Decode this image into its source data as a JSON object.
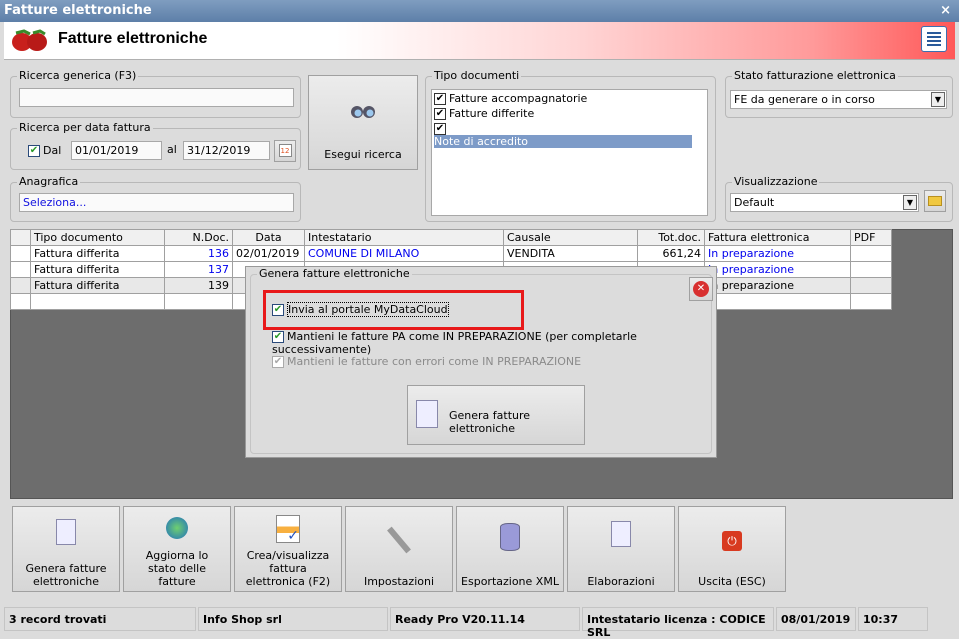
{
  "window": {
    "title": "Fatture elettroniche",
    "close": "×"
  },
  "header": {
    "title": "Fatture elettroniche"
  },
  "search": {
    "generic_label": "Ricerca generica (F3)",
    "generic_value": "",
    "date_label": "Ricerca per data fattura",
    "from_label": "Dal",
    "from": "01/01/2019",
    "to_label": "al",
    "to": "31/12/2019",
    "anag_label": "Anagrafica",
    "anag_value": "Seleziona...",
    "run_button": "Esegui ricerca"
  },
  "doc_types": {
    "label": "Tipo documenti",
    "items": [
      "Fatture accompagnatorie",
      "Fatture differite",
      "Note di accredito"
    ]
  },
  "status_filter": {
    "label": "Stato fatturazione elettronica",
    "value": "FE da generare o in corso"
  },
  "view": {
    "label": "Visualizzazione",
    "value": "Default"
  },
  "grid": {
    "columns": [
      "Tipo documento",
      "N.Doc.",
      "Data",
      "Intestatario",
      "Causale",
      "Tot.doc.",
      "Fattura elettronica",
      "PDF"
    ],
    "rows": [
      [
        "Fattura differita",
        "136",
        "02/01/2019",
        "COMUNE DI MILANO",
        "VENDITA",
        "661,24",
        "In preparazione",
        ""
      ],
      [
        "Fattura differita",
        "137",
        "",
        "",
        "",
        "",
        "In preparazione",
        ""
      ],
      [
        "Fattura differita",
        "139",
        "",
        "",
        "",
        "",
        "In preparazione",
        ""
      ]
    ]
  },
  "dialog": {
    "title": "Genera fatture elettroniche",
    "opt1": "Invia al portale MyDataCloud",
    "opt2": "Mantieni le fatture PA come IN PREPARAZIONE (per completarle successivamente)",
    "opt3": "Mantieni le fatture con errori come IN PREPARAZIONE",
    "button": "Genera fatture elettroniche"
  },
  "toolbar": [
    "Genera fatture elettroniche",
    "Aggiorna lo stato delle fatture",
    "Crea/visualizza fattura elettronica (F2)",
    "Impostazioni",
    "Esportazione XML",
    "Elaborazioni",
    "Uscita (ESC)"
  ],
  "statusbar": {
    "records": "3 record trovati",
    "company": "Info Shop srl",
    "version": "Ready Pro V20.11.14",
    "license": "Intestatario licenza : CODICE SRL",
    "date": "08/01/2019",
    "time": "10:37"
  }
}
